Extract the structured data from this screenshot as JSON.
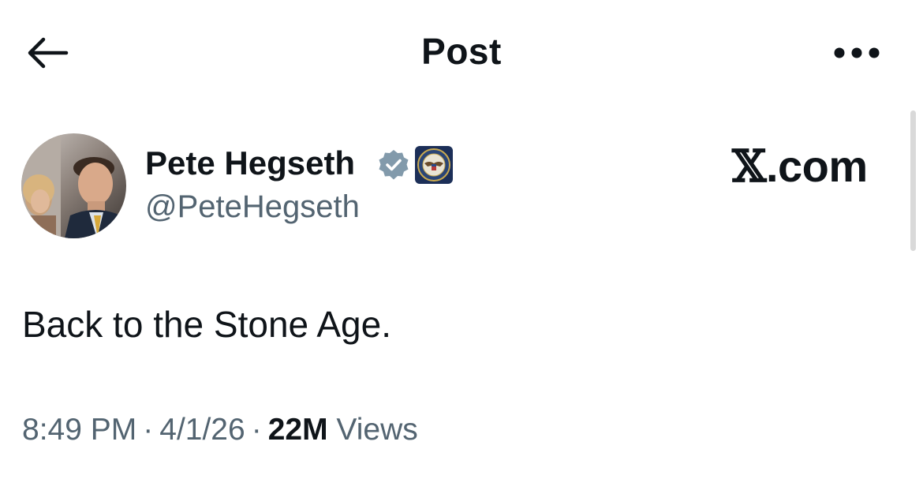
{
  "header": {
    "title": "Post"
  },
  "post": {
    "author": {
      "display_name": "Pete Hegseth",
      "handle": "@PeteHegseth",
      "verified": true,
      "affiliate_badge": "department-of-defense-seal-icon"
    },
    "watermark": {
      "x_glyph": "𝕏",
      "suffix": ".com"
    },
    "text": "Back to the Stone Age.",
    "meta": {
      "time": "8:49 PM",
      "date": "4/1/26",
      "views_count": "22M",
      "views_label": "Views",
      "separator": "·"
    }
  },
  "colors": {
    "text_primary": "#0f1419",
    "text_secondary": "#536471",
    "verified_badge": "#829aab",
    "background": "#ffffff"
  }
}
